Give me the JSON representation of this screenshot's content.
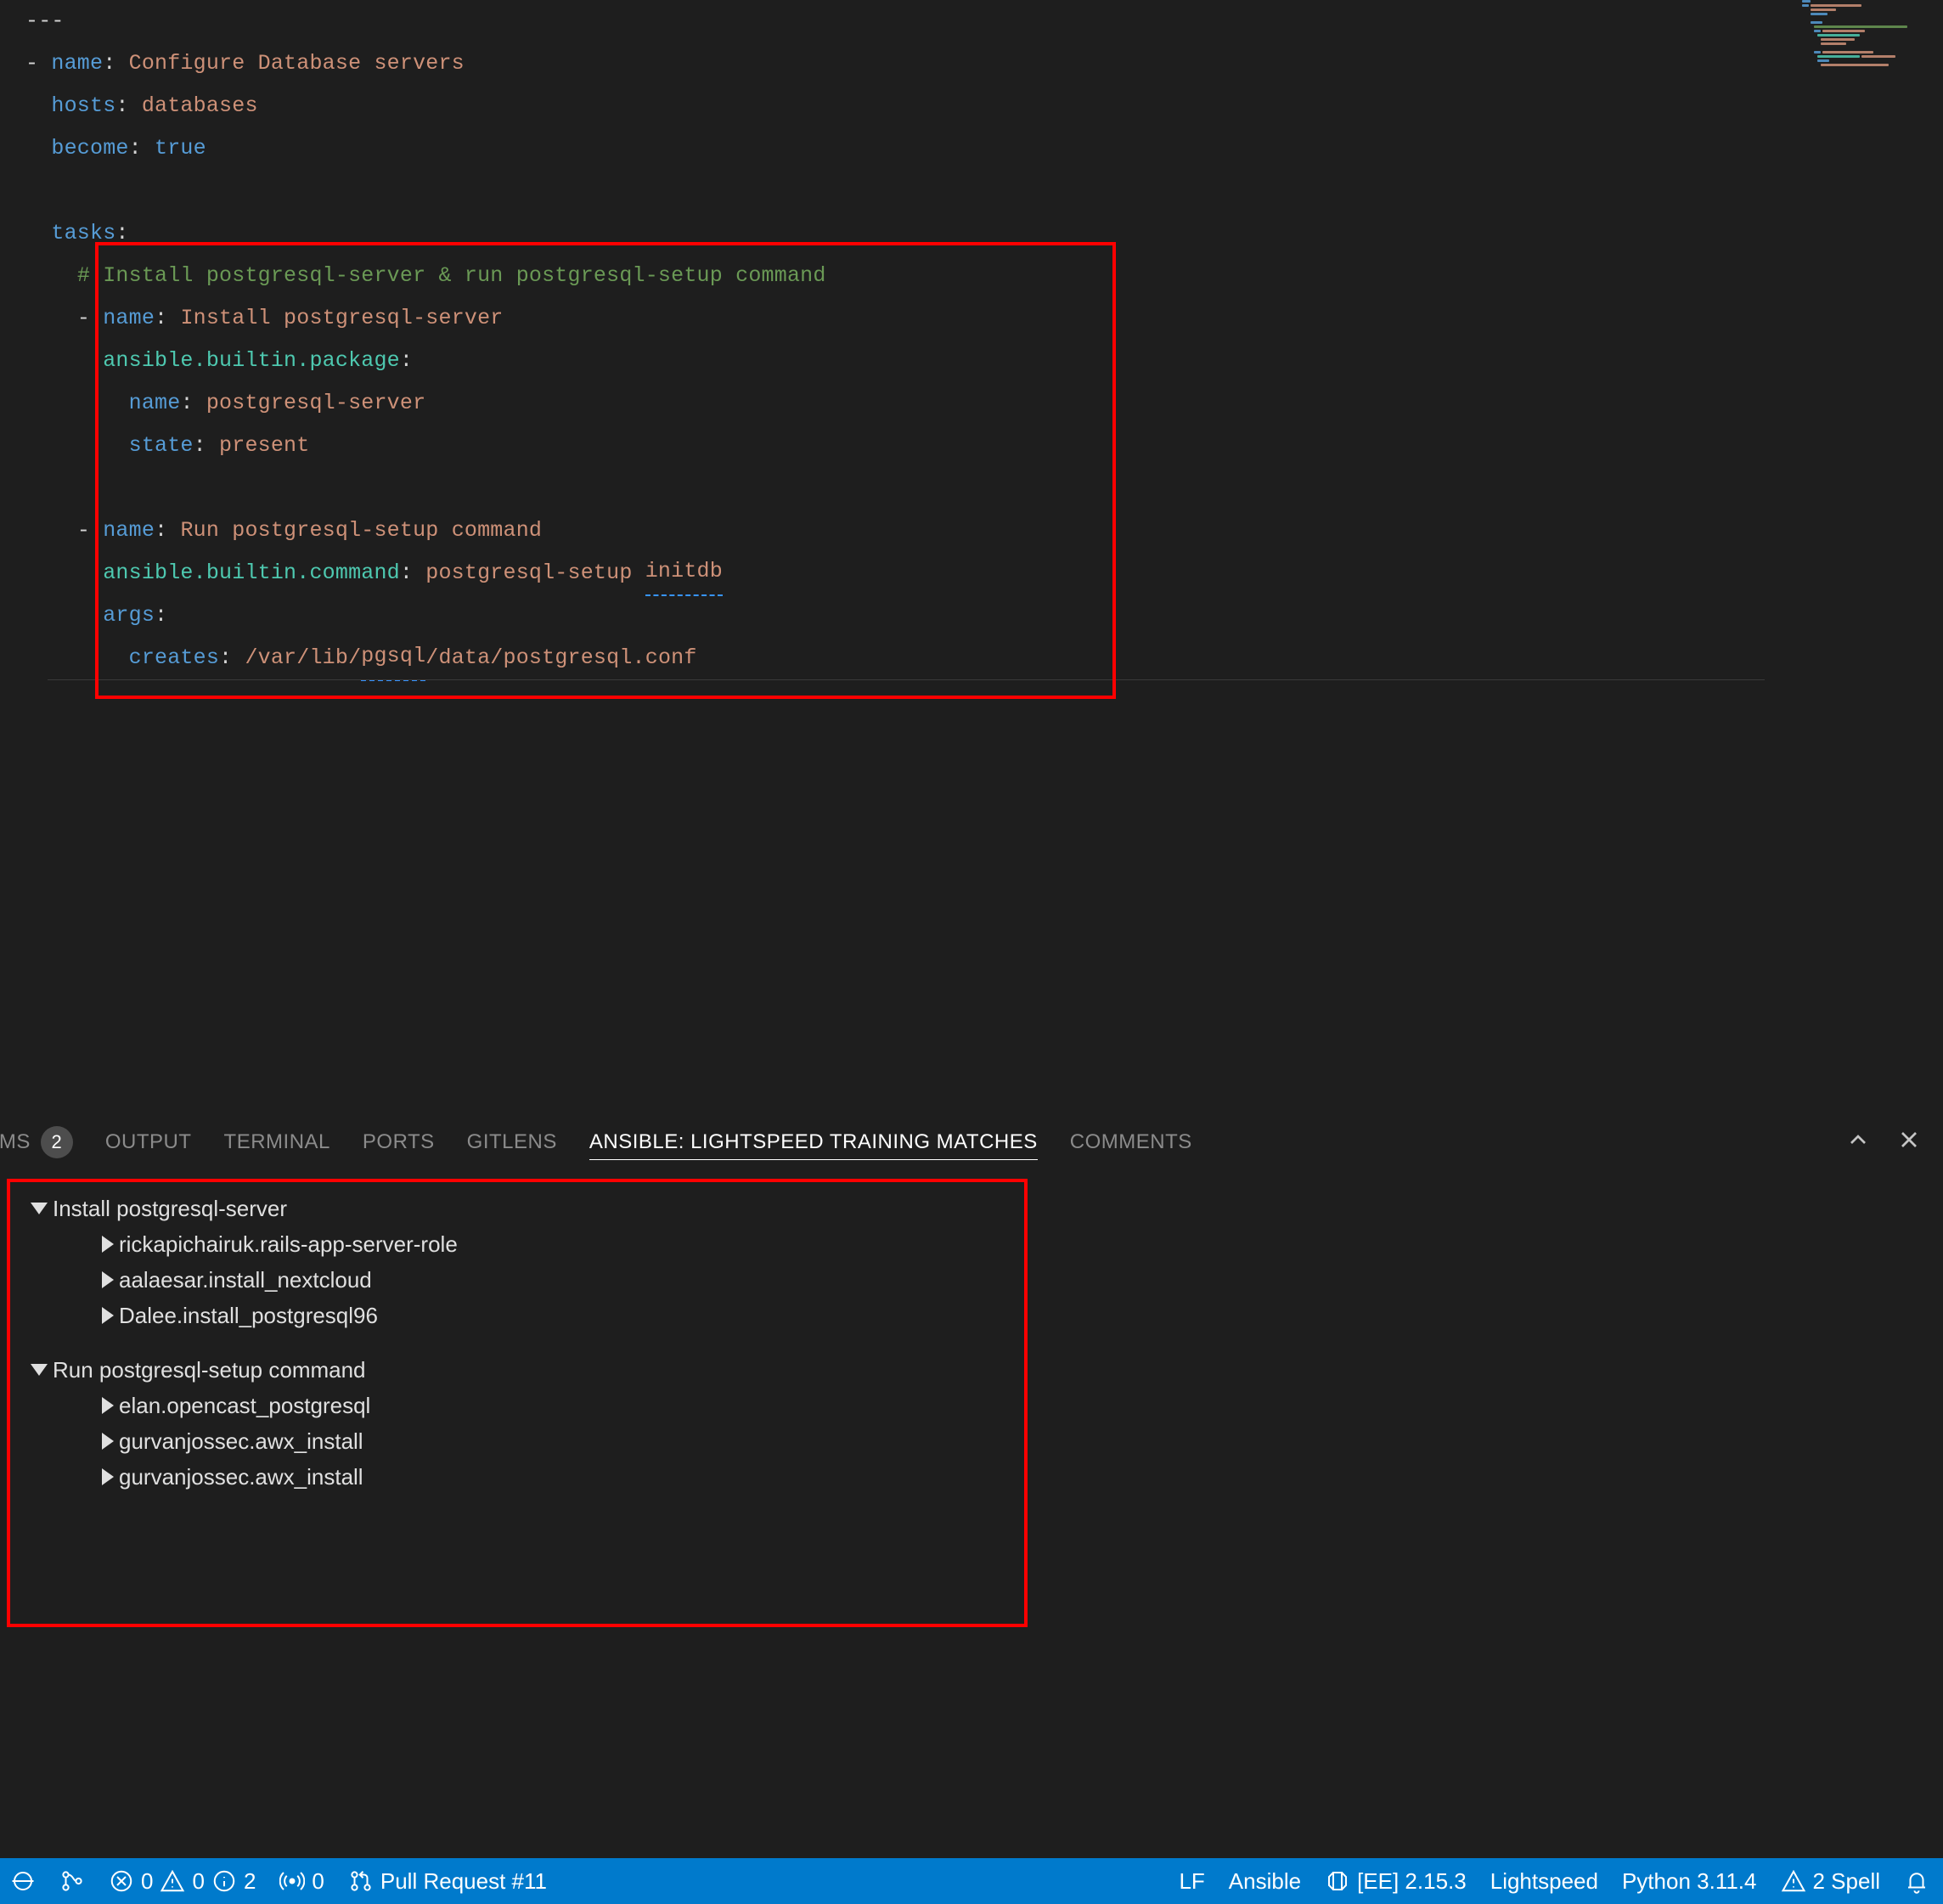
{
  "editor": {
    "lines": [
      {
        "indent": 0,
        "content": [
          {
            "c": "dash",
            "t": "---"
          }
        ]
      },
      {
        "indent": 0,
        "content": [
          {
            "c": "dash",
            "t": "- "
          },
          {
            "c": "key",
            "t": "name"
          },
          {
            "c": "colon",
            "t": ": "
          },
          {
            "c": "value-str",
            "t": "Configure Database servers"
          }
        ]
      },
      {
        "indent": 1,
        "content": [
          {
            "c": "key",
            "t": "hosts"
          },
          {
            "c": "colon",
            "t": ": "
          },
          {
            "c": "value-str",
            "t": "databases"
          }
        ]
      },
      {
        "indent": 1,
        "content": [
          {
            "c": "key",
            "t": "become"
          },
          {
            "c": "colon",
            "t": ": "
          },
          {
            "c": "value-bool",
            "t": "true"
          }
        ]
      },
      {
        "indent": 1,
        "content": []
      },
      {
        "indent": 1,
        "content": [
          {
            "c": "key",
            "t": "tasks"
          },
          {
            "c": "colon",
            "t": ":"
          }
        ]
      },
      {
        "indent": 2,
        "content": [
          {
            "c": "comment",
            "t": "# Install postgresql-server & run postgresql-setup command"
          }
        ]
      },
      {
        "indent": 2,
        "content": [
          {
            "c": "dash",
            "t": "- "
          },
          {
            "c": "key",
            "t": "name"
          },
          {
            "c": "colon",
            "t": ": "
          },
          {
            "c": "value-str",
            "t": "Install postgresql-server"
          }
        ]
      },
      {
        "indent": 3,
        "content": [
          {
            "c": "key-alt",
            "t": "ansible.builtin.package"
          },
          {
            "c": "colon",
            "t": ":"
          }
        ]
      },
      {
        "indent": 4,
        "content": [
          {
            "c": "key",
            "t": "name"
          },
          {
            "c": "colon",
            "t": ": "
          },
          {
            "c": "value-str",
            "t": "postgresql-server"
          }
        ]
      },
      {
        "indent": 4,
        "content": [
          {
            "c": "key",
            "t": "state"
          },
          {
            "c": "colon",
            "t": ": "
          },
          {
            "c": "value-str",
            "t": "present"
          }
        ]
      },
      {
        "indent": 2,
        "content": []
      },
      {
        "indent": 2,
        "content": [
          {
            "c": "dash",
            "t": "- "
          },
          {
            "c": "key",
            "t": "name"
          },
          {
            "c": "colon",
            "t": ": "
          },
          {
            "c": "value-str",
            "t": "Run postgresql-setup command"
          }
        ]
      },
      {
        "indent": 3,
        "content": [
          {
            "c": "key-alt",
            "t": "ansible.builtin.command"
          },
          {
            "c": "colon",
            "t": ": "
          },
          {
            "c": "value-str",
            "t": "postgresql-setup "
          },
          {
            "c": "value-str squiggle",
            "t": "initdb"
          }
        ]
      },
      {
        "indent": 3,
        "content": [
          {
            "c": "key",
            "t": "args"
          },
          {
            "c": "colon",
            "t": ":"
          }
        ]
      },
      {
        "indent": 4,
        "content": [
          {
            "c": "key",
            "t": "creates"
          },
          {
            "c": "colon",
            "t": ": "
          },
          {
            "c": "value-str",
            "t": "/var/lib/"
          },
          {
            "c": "value-str squiggle",
            "t": "pgsql"
          },
          {
            "c": "value-str",
            "t": "/data/postgresql.conf"
          }
        ]
      }
    ]
  },
  "panel": {
    "tabs": [
      {
        "label": "BLEMS",
        "badge": "2",
        "active": false,
        "truncated": true
      },
      {
        "label": "OUTPUT",
        "active": false
      },
      {
        "label": "TERMINAL",
        "active": false
      },
      {
        "label": "PORTS",
        "active": false
      },
      {
        "label": "GITLENS",
        "active": false
      },
      {
        "label": "ANSIBLE: LIGHTSPEED TRAINING MATCHES",
        "active": true
      },
      {
        "label": "COMMENTS",
        "active": false
      }
    ],
    "tree": [
      {
        "name": "Install postgresql-server",
        "children": [
          "rickapichairuk.rails-app-server-role",
          "aalaesar.install_nextcloud",
          "Dalee.install_postgresql96"
        ]
      },
      {
        "name": "Run postgresql-setup command",
        "children": [
          "elan.opencast_postgresql",
          "gurvanjossec.awx_install",
          "gurvanjossec.awx_install"
        ]
      }
    ]
  },
  "status": {
    "errors": "0",
    "warnings": "0",
    "info": "2",
    "radio": "0",
    "pr": "Pull Request #11",
    "eol": "LF",
    "lang": "Ansible",
    "ee": "[EE] 2.15.3",
    "lightspeed": "Lightspeed",
    "python": "Python 3.11.4",
    "spell": "2 Spell"
  }
}
